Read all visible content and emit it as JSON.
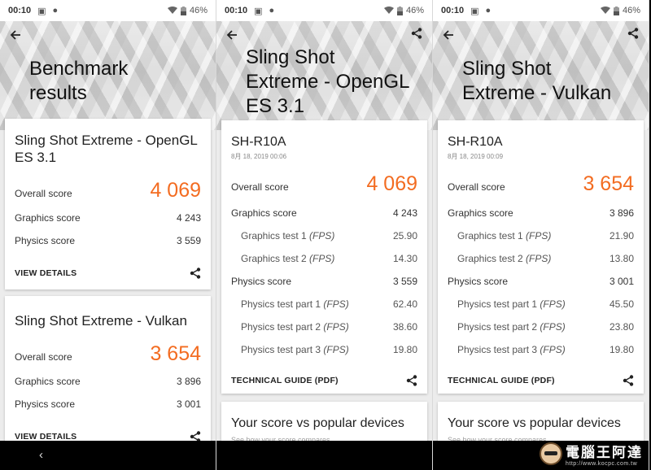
{
  "status": {
    "time": "00:10",
    "battery": "46%"
  },
  "nav": {
    "back_glyph": "‹"
  },
  "watermark": {
    "text": "電腦王阿達",
    "url": "http://www.kocpc.com.tw"
  },
  "panel1": {
    "title_line1": "Benchmark",
    "title_line2": "results",
    "card1": {
      "title_line1": "Sling Shot Extreme - OpenGL",
      "title_line2": "ES 3.1",
      "overall_label": "Overall score",
      "overall_value": "4 069",
      "graphics_label": "Graphics score",
      "graphics_value": "4 243",
      "physics_label": "Physics score",
      "physics_value": "3 559",
      "link": "VIEW DETAILS"
    },
    "card2": {
      "title": "Sling Shot Extreme - Vulkan",
      "overall_label": "Overall score",
      "overall_value": "3 654",
      "graphics_label": "Graphics score",
      "graphics_value": "3 896",
      "physics_label": "Physics score",
      "physics_value": "3 001",
      "link": "VIEW DETAILS"
    }
  },
  "panel2": {
    "title_line1": "Sling Shot",
    "title_line2": "Extreme - OpenGL",
    "title_line3": "ES 3.1",
    "device": "SH-R10A",
    "date": "8月 18, 2019 00:06",
    "overall_label": "Overall score",
    "overall_value": "4 069",
    "graphics_label": "Graphics score",
    "graphics_value": "4 243",
    "gt1_label": "Graphics test 1",
    "gt1_value": "25.90",
    "gt2_label": "Graphics test 2",
    "gt2_value": "14.30",
    "physics_label": "Physics score",
    "physics_value": "3 559",
    "pt1_label": "Physics test part 1",
    "pt1_value": "62.40",
    "pt2_label": "Physics test part 2",
    "pt2_value": "38.60",
    "pt3_label": "Physics test part 3",
    "pt3_value": "19.80",
    "fps": "(FPS)",
    "link": "TECHNICAL GUIDE (PDF)",
    "popular": "Your score vs popular devices",
    "popular_sub": "See how your score compares..."
  },
  "panel3": {
    "title_line1": "Sling Shot",
    "title_line2": "Extreme - Vulkan",
    "device": "SH-R10A",
    "date": "8月 18, 2019 00:09",
    "overall_label": "Overall score",
    "overall_value": "3 654",
    "graphics_label": "Graphics score",
    "graphics_value": "3 896",
    "gt1_label": "Graphics test 1",
    "gt1_value": "21.90",
    "gt2_label": "Graphics test 2",
    "gt2_value": "13.80",
    "physics_label": "Physics score",
    "physics_value": "3 001",
    "pt1_label": "Physics test part 1",
    "pt1_value": "45.50",
    "pt2_label": "Physics test part 2",
    "pt2_value": "23.80",
    "pt3_label": "Physics test part 3",
    "pt3_value": "19.80",
    "fps": "(FPS)",
    "link": "TECHNICAL GUIDE (PDF)",
    "popular": "Your score vs popular devices",
    "popular_sub": "See how your score compares..."
  },
  "colors": {
    "accent": "#f36c21",
    "card": "#ffffff"
  },
  "icons": {
    "back": "arrow-left-icon",
    "share": "share-icon",
    "wifi": "wifi-icon",
    "battery": "battery-icon"
  }
}
